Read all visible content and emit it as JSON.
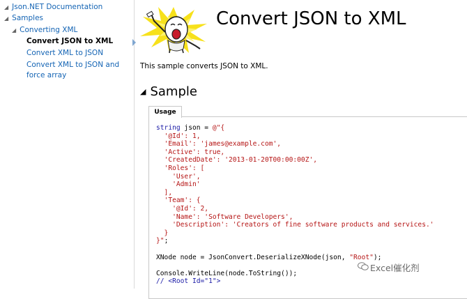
{
  "sidebar": {
    "items": [
      {
        "label": "Json.NET Documentation"
      },
      {
        "label": "Samples"
      },
      {
        "label": "Converting XML"
      },
      {
        "label": "Convert JSON to XML"
      },
      {
        "label": "Convert XML to JSON"
      },
      {
        "label": "Convert XML to JSON and force array"
      }
    ],
    "bullet": "◢"
  },
  "page": {
    "title": "Convert JSON to XML",
    "description": "This sample converts JSON to XML.",
    "section_title": "Sample",
    "section_toggle": "◢"
  },
  "code_tab": {
    "label": "Usage"
  },
  "code": {
    "lines": [
      [
        {
          "t": "kw",
          "v": "string"
        },
        {
          "t": "pl",
          "v": " json = "
        },
        {
          "t": "str",
          "v": "@\"{"
        }
      ],
      [
        {
          "t": "str",
          "v": "  '@Id': 1,"
        }
      ],
      [
        {
          "t": "str",
          "v": "  'Email': 'james@example.com',"
        }
      ],
      [
        {
          "t": "str",
          "v": "  'Active': true,"
        }
      ],
      [
        {
          "t": "str",
          "v": "  'CreatedDate': '2013-01-20T00:00:00Z',"
        }
      ],
      [
        {
          "t": "str",
          "v": "  'Roles': ["
        }
      ],
      [
        {
          "t": "str",
          "v": "    'User',"
        }
      ],
      [
        {
          "t": "str",
          "v": "    'Admin'"
        }
      ],
      [
        {
          "t": "str",
          "v": "  ],"
        }
      ],
      [
        {
          "t": "str",
          "v": "  'Team': {"
        }
      ],
      [
        {
          "t": "str",
          "v": "    '@Id': 2,"
        }
      ],
      [
        {
          "t": "str",
          "v": "    'Name': 'Software Developers',"
        }
      ],
      [
        {
          "t": "str",
          "v": "    'Description': 'Creators of fine software products and services.'"
        }
      ],
      [
        {
          "t": "str",
          "v": "  }"
        }
      ],
      [
        {
          "t": "str",
          "v": "}\""
        },
        {
          "t": "pl",
          "v": ";"
        }
      ],
      [],
      [
        {
          "t": "pl",
          "v": "XNode node = JsonConvert.DeserializeXNode(json, "
        },
        {
          "t": "str",
          "v": "\"Root\""
        },
        {
          "t": "pl",
          "v": ");"
        }
      ],
      [],
      [
        {
          "t": "pl",
          "v": "Console.WriteLine(node.ToString());"
        }
      ],
      [
        {
          "t": "cm",
          "v": "// <Root Id=\"1\">"
        }
      ]
    ]
  },
  "watermark": {
    "text": "Excel催化剂"
  },
  "colors": {
    "link": "#1464b4",
    "keyword": "#1a1aa6",
    "string": "#b51414",
    "tab_border": "#c8c8c8"
  }
}
